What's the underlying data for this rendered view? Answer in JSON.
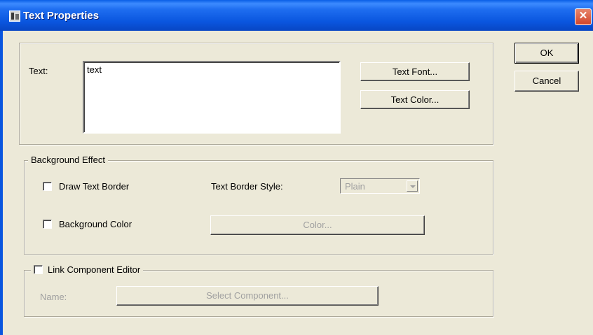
{
  "window": {
    "title": "Text Properties",
    "close_glyph": "✕"
  },
  "buttons": {
    "ok": "OK",
    "cancel": "Cancel",
    "text_font": "Text Font...",
    "text_color": "Text Color..."
  },
  "text_section": {
    "label": "Text:",
    "value": "text"
  },
  "background": {
    "legend": "Background Effect",
    "draw_border_label": "Draw Text Border",
    "border_style_label": "Text Border Style:",
    "border_style_value": "Plain",
    "bg_color_label": "Background Color",
    "color_button": "Color..."
  },
  "link": {
    "legend": "Link Component Editor",
    "name_label": "Name:",
    "select_button": "Select Component..."
  }
}
